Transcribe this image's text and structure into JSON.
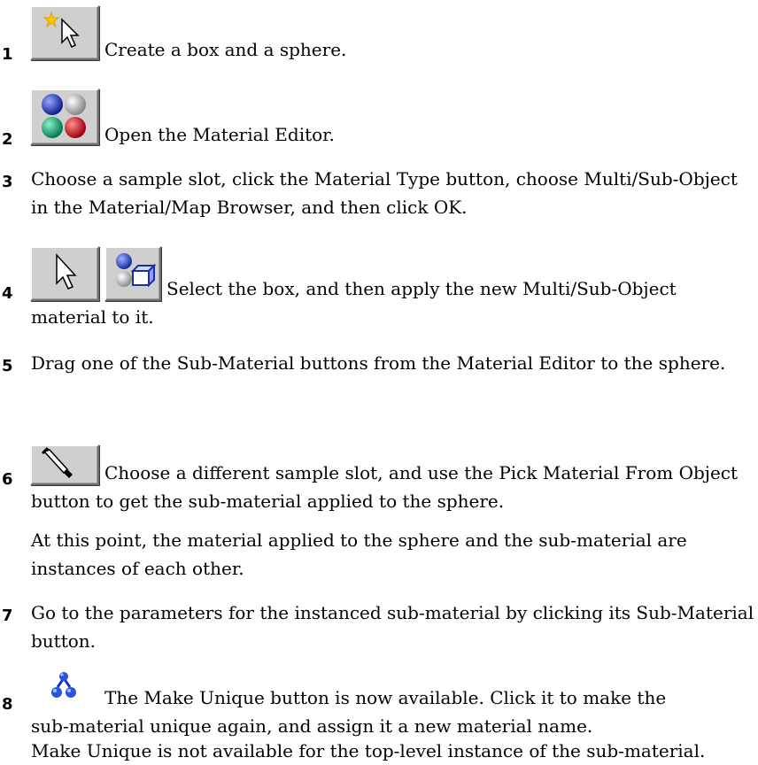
{
  "steps": [
    {
      "number": "1",
      "icons": [
        "select-create-icon"
      ],
      "text": "Create a box and a sphere."
    },
    {
      "number": "2",
      "icons": [
        "material-editor-icon"
      ],
      "text": "Open the Material Editor."
    },
    {
      "number": "3",
      "icons": [],
      "text": "Choose a sample slot, click the Material Type button, choose Multi/Sub-Object in the Material/Map Browser, and then click OK."
    },
    {
      "number": "4",
      "icons": [
        "select-object-icon",
        "assign-material-icon"
      ],
      "text_first": "Select the box, and then apply the new Multi/Sub-Object",
      "text_rest": "material to it."
    },
    {
      "number": "5",
      "icons": [],
      "text": "Drag one of the Sub-Material buttons from the Material Editor to the sphere."
    },
    {
      "number": "6",
      "icons": [
        "eyedropper-icon"
      ],
      "text_first": "Choose a different sample slot, and use the Pick Material From Object",
      "text_rest": "button to get the sub-material applied to the sphere.",
      "note": "At this point, the material applied to the sphere and the sub-material are instances of each other."
    },
    {
      "number": "7",
      "icons": [],
      "text": "Go to the parameters for the instanced sub-material by clicking its Sub-Material button."
    },
    {
      "number": "8",
      "icons": [
        "make-unique-icon"
      ],
      "text_first": "The Make Unique button is now available. Click it to make the",
      "text_rest": "sub-material unique again, and assign it a new material name.",
      "note": "Make Unique is not available for the top-level instance of the sub-material."
    }
  ]
}
